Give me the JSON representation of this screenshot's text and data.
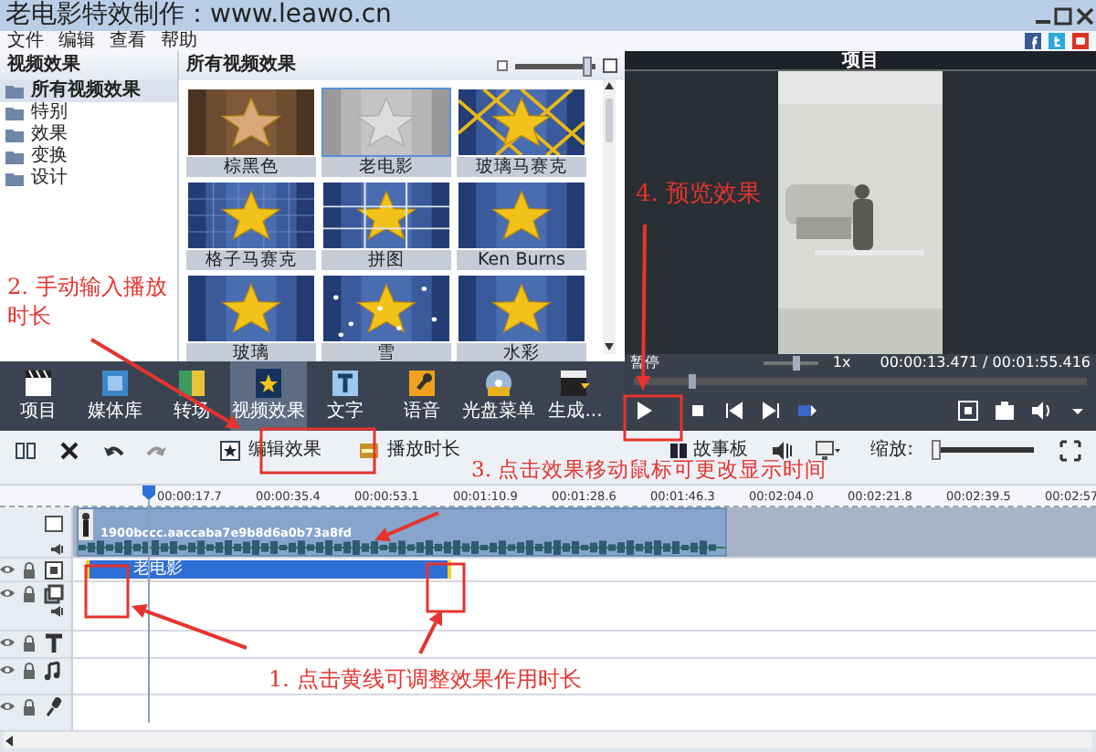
{
  "window": {
    "title": "老电影特效制作：www.leawo.cn"
  },
  "menu": [
    "文件",
    "编辑",
    "查看",
    "帮助"
  ],
  "effects_sidebar": {
    "title": "视频效果",
    "items": [
      {
        "label": "所有视频效果",
        "selected": true
      },
      {
        "label": "特别",
        "selected": false
      },
      {
        "label": "效果",
        "selected": false
      },
      {
        "label": "变换",
        "selected": false
      },
      {
        "label": "设计",
        "selected": false
      }
    ]
  },
  "effects_grid": {
    "title": "所有视频效果",
    "size_slider": {
      "level": 0.92
    },
    "items": [
      {
        "label": "棕黑色",
        "kind": "sepia",
        "selected": false
      },
      {
        "label": "老电影",
        "kind": "gray",
        "selected": true
      },
      {
        "label": "玻璃马赛克",
        "kind": "mosaic",
        "selected": false
      },
      {
        "label": "格子马赛克",
        "kind": "pixel",
        "selected": false
      },
      {
        "label": "拼图",
        "kind": "puzzle",
        "selected": false
      },
      {
        "label": "Ken Burns",
        "kind": "plain",
        "selected": false
      },
      {
        "label": "玻璃",
        "kind": "plain",
        "selected": false
      },
      {
        "label": "雪",
        "kind": "snow",
        "selected": false
      },
      {
        "label": "水彩",
        "kind": "plain",
        "selected": false
      }
    ]
  },
  "preview": {
    "title": "项目",
    "status": "暂停",
    "speed_slider": {
      "level": 0.6
    },
    "speed": "1x",
    "time": "00:00:13.471 / 00:01:55.416",
    "seek_bar": {
      "level": 0.12
    }
  },
  "toolbar": [
    {
      "label": "项目",
      "selected": false
    },
    {
      "label": "媒体库",
      "selected": false
    },
    {
      "label": "转场",
      "selected": false
    },
    {
      "label": "视频效果",
      "selected": true
    },
    {
      "label": "文字",
      "selected": false
    },
    {
      "label": "语音",
      "selected": false
    },
    {
      "label": "光盘菜单",
      "selected": false
    },
    {
      "label": "生成...",
      "selected": false
    }
  ],
  "timeline_toolbar": {
    "buttons": [
      "编辑效果",
      "播放时长"
    ],
    "storyboard": "故事板",
    "zoom_label": "缩放:",
    "zoom_slider": {
      "level": 0.04
    }
  },
  "ruler": [
    "00:00:17.7",
    "00:00:35.4",
    "00:00:53.1",
    "00:01:10.9",
    "00:01:28.6",
    "00:01:46.3",
    "00:02:04.0",
    "00:02:21.8",
    "00:02:39.5",
    "00:02:57"
  ],
  "tracks": [
    {
      "kind": "video",
      "clip": "1900bccc.aaccaba7e9b8d6a0b73a8fd"
    },
    {
      "kind": "effect",
      "clip": "老电影"
    },
    {
      "kind": "overlay"
    },
    {
      "kind": "text"
    },
    {
      "kind": "music"
    },
    {
      "kind": "voice"
    }
  ],
  "annotations": [
    {
      "text": "4. 预览效果"
    },
    {
      "text": "2. 手动输入播放时长"
    },
    {
      "text": "3. 点击效果移动鼠标可更改显示时间"
    },
    {
      "text": "1. 点击黄线可调整效果作用时长"
    }
  ]
}
